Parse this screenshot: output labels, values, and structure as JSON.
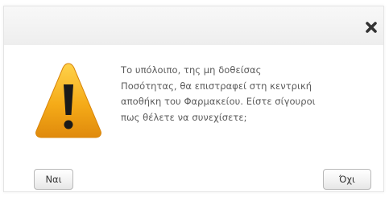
{
  "dialog": {
    "close_icon": "close-x-icon",
    "warning_icon": "warning-triangle-icon",
    "message_lines": [
      "Το υπόλοιπο, της μη δοθείσας",
      "Ποσότητας, θα επιστραφεί στη κεντρική",
      "αποθήκη του Φαρμακείου. Είστε σίγουροι",
      "πως θέλετε να συνεχίσετε;"
    ],
    "buttons": {
      "yes_label": "Ναι",
      "no_label": "Όχι"
    }
  },
  "colors": {
    "warning_fill": "#f2a818",
    "warning_mark": "#1a1a1a"
  }
}
